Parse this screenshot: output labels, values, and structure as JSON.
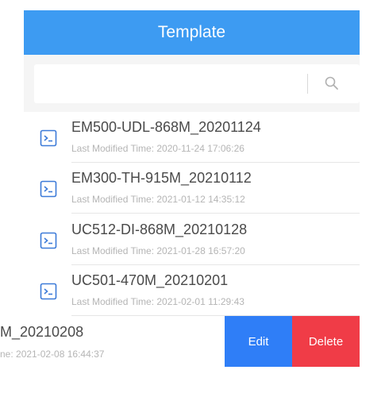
{
  "header": {
    "title": "Template"
  },
  "search": {
    "value": "",
    "placeholder": ""
  },
  "colors": {
    "header_bg": "#3d9bf2",
    "edit_bg": "#2f7ef7",
    "delete_bg": "#f03c47",
    "icon_blue": "#3d7bd8"
  },
  "list": {
    "item_icon": "terminal-file-icon",
    "items": [
      {
        "title": "EM500-UDL-868M_20201124",
        "subtitle": "Last Modified Time: 2020-11-24 17:06:26"
      },
      {
        "title": "EM300-TH-915M_20210112",
        "subtitle": "Last Modified Time: 2021-01-12 14:35:12"
      },
      {
        "title": "UC512-DI-868M_20210128",
        "subtitle": "Last Modified Time: 2021-01-28 16:57:20"
      },
      {
        "title": "UC501-470M_20210201",
        "subtitle": "Last Modified Time: 2021-02-01 11:29:43"
      }
    ],
    "swiped_item": {
      "title": "M_20210208",
      "subtitle": "ne: 2021-02-08 16:44:37"
    }
  },
  "actions": {
    "edit_label": "Edit",
    "delete_label": "Delete"
  }
}
